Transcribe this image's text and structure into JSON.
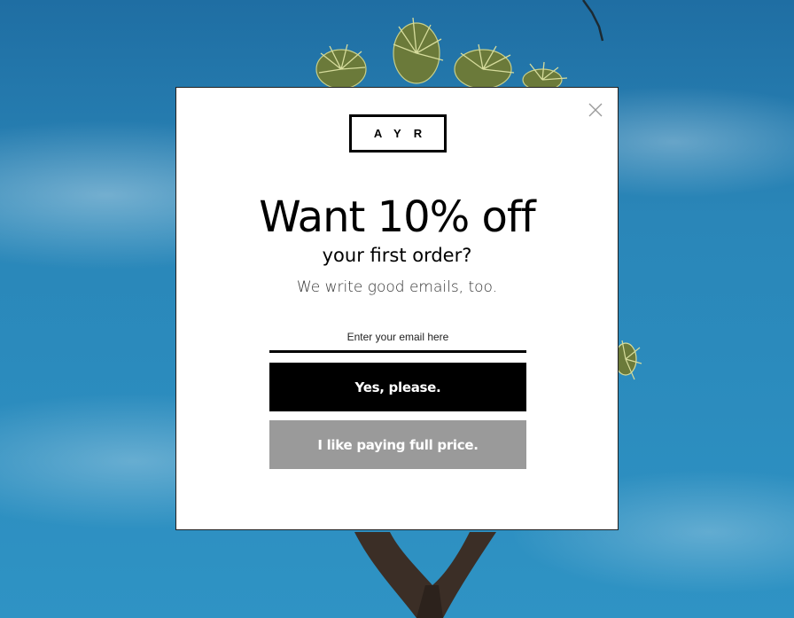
{
  "popup": {
    "logo_text": "AYR",
    "headline": "Want 10% off",
    "subheadline": "your first order?",
    "tagline": "We write good emails, too.",
    "email_placeholder": "Enter your email here",
    "email_value": "",
    "accept_label": "Yes, please.",
    "decline_label": "I like paying full price.",
    "close_icon": "close-icon"
  },
  "colors": {
    "sky": "#2b8bbd",
    "accept_bg": "#000000",
    "decline_bg": "#9a9a9a",
    "modal_bg": "#ffffff"
  }
}
